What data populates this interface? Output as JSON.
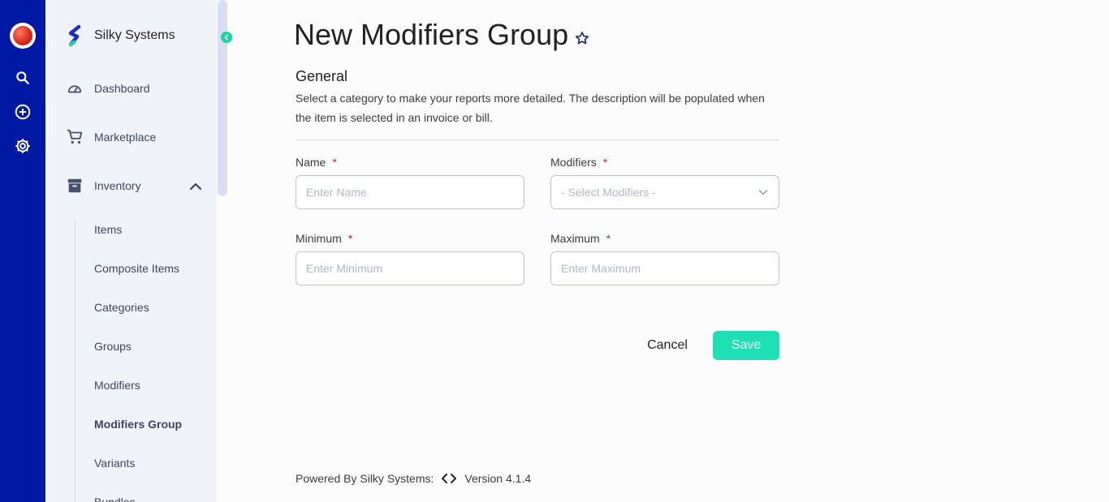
{
  "brand": {
    "name": "Silky Systems"
  },
  "nav": {
    "dashboard": "Dashboard",
    "marketplace": "Marketplace",
    "inventory": "Inventory",
    "sub_items": [
      "Items",
      "Composite Items",
      "Categories",
      "Groups",
      "Modifiers",
      "Modifiers Group",
      "Variants",
      "Bundles"
    ],
    "active_sub_item": "Modifiers Group"
  },
  "page": {
    "title": "New Modifiers Group"
  },
  "section": {
    "title": "General",
    "description": "Select a category to make your reports more detailed. The description will be populated when the item is selected in an invoice or bill."
  },
  "form": {
    "required_mark": "*",
    "name": {
      "label": "Name",
      "placeholder": "Enter Name",
      "value": ""
    },
    "modifiers": {
      "label": "Modifiers",
      "placeholder": "- Select Modifiers -"
    },
    "minimum": {
      "label": "Minimum",
      "placeholder": "Enter Minimum",
      "value": ""
    },
    "maximum": {
      "label": "Maximum",
      "placeholder": "Enter Maximum",
      "value": ""
    }
  },
  "actions": {
    "cancel": "Cancel",
    "save": "Save"
  },
  "footer": {
    "powered_by": "Powered By Silky Systems:",
    "version": "Version 4.1.4"
  },
  "icons": {
    "rail": [
      "avatar-apple",
      "search-icon",
      "add-circle-icon",
      "settings-gear-icon"
    ],
    "nav": [
      "speedometer-icon",
      "cart-icon",
      "archive-box-icon"
    ]
  },
  "colors": {
    "rail": "#0019a4",
    "sidebar": "#f1f3fb",
    "accent": "#1fe0b4",
    "required": "#cc2a2a"
  }
}
